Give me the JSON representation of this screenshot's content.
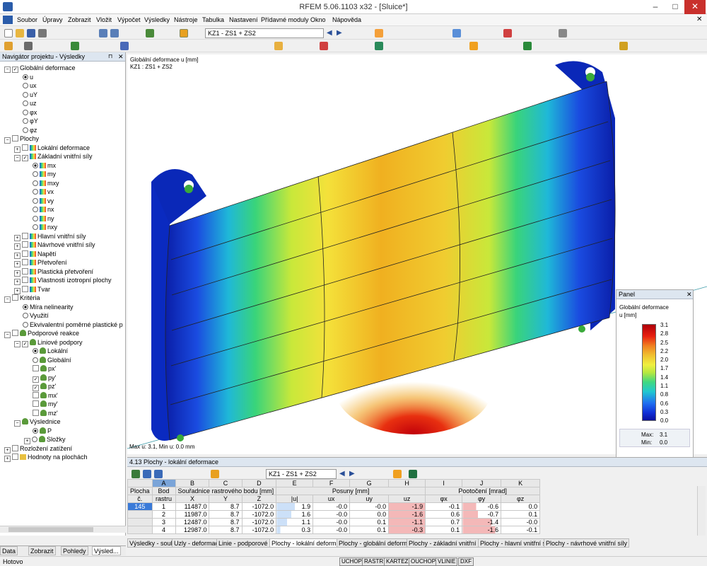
{
  "window": {
    "title": "RFEM 5.06.1103 x32 - [Sluice*]"
  },
  "menu": [
    "Soubor",
    "Úpravy",
    "Zobrazit",
    "Vložit",
    "Výpočet",
    "Výsledky",
    "Nástroje",
    "Tabulka",
    "Nastavení",
    "Přídavné moduly",
    "Okno",
    "Nápověda"
  ],
  "toolbar": {
    "load_case": "KZ1 - ZS1 + ZS2"
  },
  "navigator": {
    "title": "Navigátor projektu - Výsledky",
    "items": [
      "Globální deformace",
      "u",
      "ux",
      "uY",
      "uz",
      "φx",
      "φY",
      "φz",
      "Plochy",
      "Lokální deformace",
      "Základní vnitřní síly",
      "mx",
      "my",
      "mxy",
      "vx",
      "vy",
      "nx",
      "ny",
      "nxy",
      "Hlavní vnitřní síly",
      "Návrhové vnitřní síly",
      "Napětí",
      "Přetvoření",
      "Plastická přetvoření",
      "Vlastnosti izotropní plochy",
      "Tvar",
      "Kritéria",
      "Míra nelinearity",
      "Využití",
      "Ekvivalentní poměrné plastické p",
      "Podporové reakce",
      "Liniové podpory",
      "Lokální",
      "Globální",
      "px'",
      "py'",
      "pz'",
      "mx'",
      "my'",
      "mz'",
      "Výslednice",
      "P",
      "Složky",
      "Rozložení zatížení",
      "Hodnoty na plochách"
    ],
    "tabs": [
      "Data",
      "Zobrazit",
      "Pohledy",
      "Výsled..."
    ]
  },
  "viewport": {
    "label1": "Globální deformace u [mm]",
    "label2": "KZ1 : ZS1 + ZS2",
    "maxmin": "Max u: 3.1, Min u: 0.0 mm"
  },
  "legend": {
    "title": "Panel",
    "label1": "Globální deformace",
    "label2": "u [mm]",
    "values": [
      "3.1",
      "2.8",
      "2.5",
      "2.2",
      "2.0",
      "1.7",
      "1.4",
      "1.1",
      "0.8",
      "0.6",
      "0.3",
      "0.0"
    ],
    "max_label": "Max:",
    "max_val": "3.1",
    "min_label": "Min:",
    "min_val": "0.0"
  },
  "table": {
    "title": "4.13 Plochy - lokální deformace",
    "load_case": "KZ1 - ZS1 + ZS2",
    "col_letters": [
      "A",
      "B",
      "C",
      "D",
      "E",
      "F",
      "G",
      "H",
      "I",
      "J",
      "K"
    ],
    "h1": [
      "Plocha",
      "Bod",
      "Souřadnice rastrového bodu [mm]",
      "Posuny [mm]",
      "Pootočení [mrad]"
    ],
    "h2": [
      "č.",
      "rastru",
      "X",
      "Y",
      "Z",
      "|u|",
      "ux",
      "uy",
      "uz",
      "φx",
      "φy",
      "φz"
    ],
    "rows": [
      [
        "145",
        "1",
        "11487.0",
        "8.7",
        "-1072.0",
        "1.9",
        "-0.0",
        "-0.0",
        "-1.9",
        "-0.1",
        "-0.6",
        "0.0"
      ],
      [
        "",
        "2",
        "11987.0",
        "8.7",
        "-1072.0",
        "1.6",
        "-0.0",
        "0.0",
        "-1.6",
        "0.6",
        "-0.7",
        "0.1"
      ],
      [
        "",
        "3",
        "12487.0",
        "8.7",
        "-1072.0",
        "1.1",
        "-0.0",
        "0.1",
        "-1.1",
        "0.7",
        "-1.4",
        "-0.0"
      ],
      [
        "",
        "4",
        "12987.0",
        "8.7",
        "-1072.0",
        "0.3",
        "-0.0",
        "0.1",
        "-0.3",
        "0.1",
        "-1.6",
        "-0.1"
      ]
    ],
    "tabs": [
      "Výsledky - souhrn",
      "Uzly - deformace",
      "Linie - podporové síly",
      "Plochy - lokální deformace",
      "Plochy - globální deformace",
      "Plochy - základní vnitřní síly",
      "Plochy - hlavní vnitřní síly",
      "Plochy - návrhové vnitřní síly"
    ]
  },
  "status": {
    "text": "Hotovo",
    "buttons": [
      "UCHOP",
      "RASTR",
      "KARTEZ",
      "OUCHOP",
      "VLINIE",
      "DXF"
    ]
  }
}
